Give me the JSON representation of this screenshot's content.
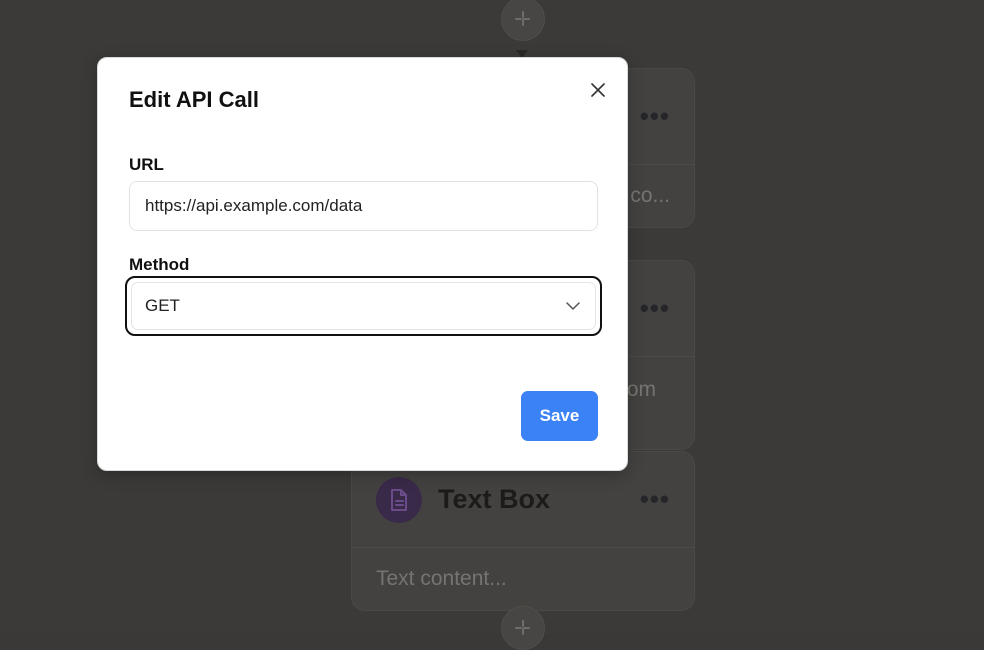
{
  "modal": {
    "title": "Edit API Call",
    "url_label": "URL",
    "url_value": "https://api.example.com/data",
    "method_label": "Method",
    "method_value": "GET",
    "save_label": "Save"
  },
  "background_nodes": {
    "card1_body": "co...",
    "card2_body": "om",
    "text_box": {
      "title": "Text Box",
      "body": "Text content...",
      "menu": "•••"
    }
  },
  "colors": {
    "accent": "#3b82f6",
    "overlay_bg": "#3b3a38",
    "text_icon_bg": "#3a2a4a"
  }
}
